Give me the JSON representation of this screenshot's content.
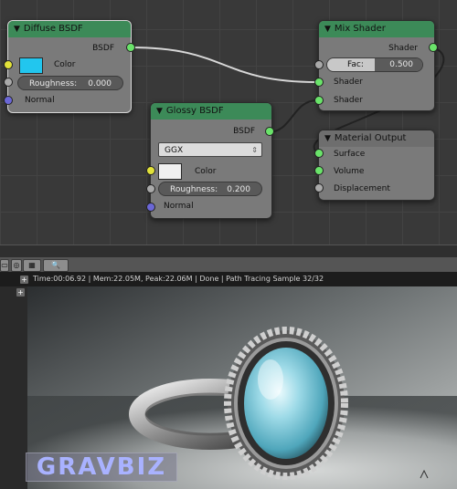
{
  "node_editor": {
    "diffuse": {
      "title": "Diffuse BSDF",
      "output_label": "BSDF",
      "color_label": "Color",
      "color_value": "#22c6ee",
      "roughness_label": "Roughness:",
      "roughness_value": "0.000",
      "normal_label": "Normal"
    },
    "glossy": {
      "title": "Glossy BSDF",
      "output_label": "BSDF",
      "distribution": "GGX",
      "color_label": "Color",
      "color_value": "#f0f0f0",
      "roughness_label": "Roughness:",
      "roughness_value": "0.200",
      "normal_label": "Normal"
    },
    "mix": {
      "title": "Mix Shader",
      "output_label": "Shader",
      "fac_label": "Fac:",
      "fac_value": "0.500",
      "fac_fraction": 0.5,
      "shader1_label": "Shader",
      "shader2_label": "Shader"
    },
    "output": {
      "title": "Material Output",
      "surface_label": "Surface",
      "volume_label": "Volume",
      "displacement_label": "Displacement"
    }
  },
  "render": {
    "info": "Time:00:06.92 | Mem:22.05M, Peak:22.06M | Done | Path Tracing Sample 32/32",
    "watermark": "GRAVBIZ"
  },
  "colors": {
    "header_green": "#3c8a58",
    "socket_green": "#6ae36a",
    "socket_yellow": "#e2e23a",
    "socket_gray": "#a9a9a9",
    "socket_blue": "#6b67d6"
  }
}
